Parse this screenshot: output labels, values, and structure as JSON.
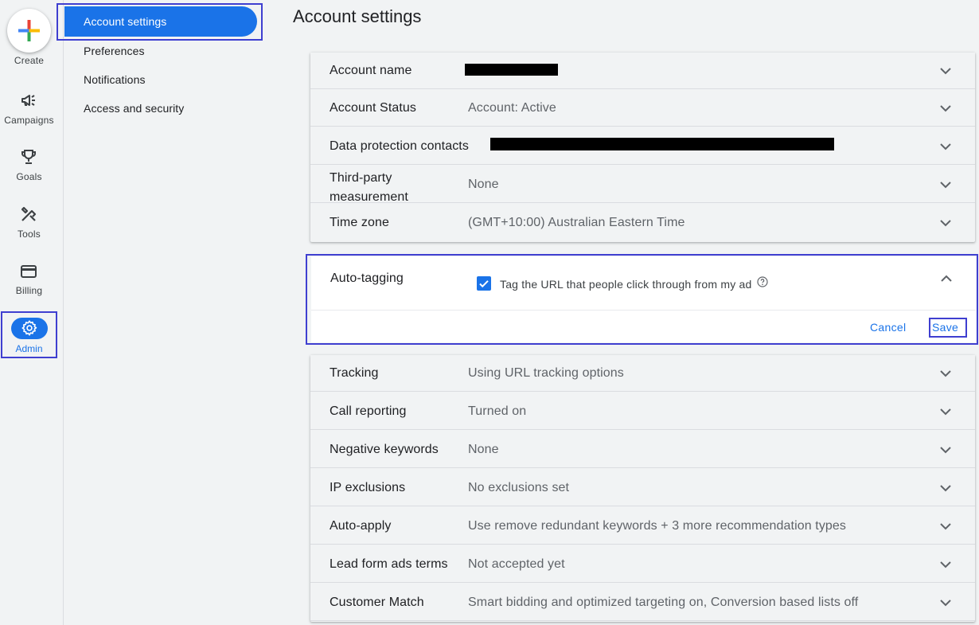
{
  "rail": {
    "create": "Create",
    "campaigns": "Campaigns",
    "goals": "Goals",
    "tools": "Tools",
    "billing": "Billing",
    "admin": "Admin"
  },
  "subnav": {
    "active": "Account settings",
    "items": [
      "Preferences",
      "Notifications",
      "Access and security"
    ]
  },
  "page_title": "Account settings",
  "rows_top": [
    {
      "label": "Account name",
      "value": ""
    },
    {
      "label": "Account Status",
      "value": "Account: Active"
    },
    {
      "label": "Data protection contacts",
      "value": ""
    },
    {
      "label": "Third-party measurement",
      "value": "None"
    },
    {
      "label": "Time zone",
      "value": "(GMT+10:00) Australian Eastern Time"
    }
  ],
  "auto_tagging": {
    "label": "Auto-tagging",
    "checkbox_label": "Tag the URL that people click through from my ad",
    "checked": true,
    "cancel": "Cancel",
    "save": "Save"
  },
  "rows_bottom": [
    {
      "label": "Tracking",
      "value": "Using URL tracking options"
    },
    {
      "label": "Call reporting",
      "value": "Turned on"
    },
    {
      "label": "Negative keywords",
      "value": "None"
    },
    {
      "label": "IP exclusions",
      "value": "No exclusions set"
    },
    {
      "label": "Auto-apply",
      "value": "Use remove redundant keywords + 3 more recommendation types"
    },
    {
      "label": "Lead form ads terms",
      "value": "Not accepted yet"
    },
    {
      "label": "Customer Match",
      "value": "Smart bidding and optimized targeting on, Conversion based lists off"
    }
  ],
  "colors": {
    "accent": "#1a73e8",
    "highlight": "#3f3fd0"
  }
}
